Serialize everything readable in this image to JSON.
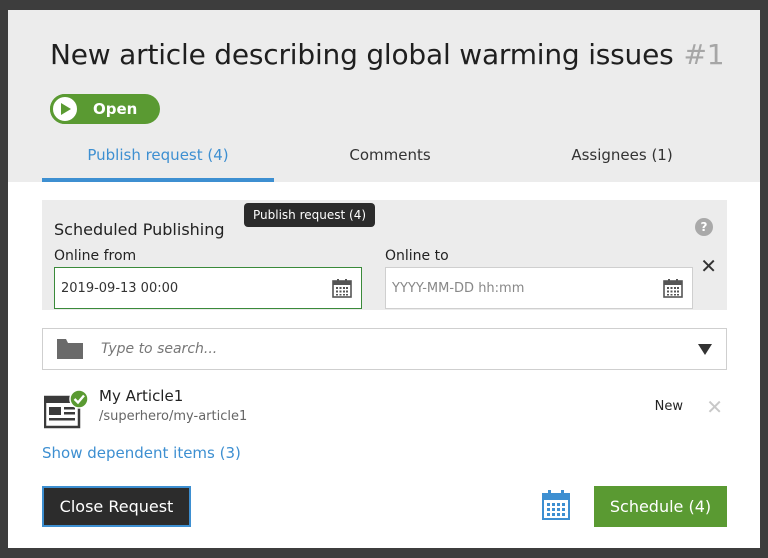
{
  "header": {
    "title": "New article describing global warming issues",
    "number": "#1",
    "status": "Open"
  },
  "tabs": [
    {
      "label": "Publish request (4)",
      "active": true
    },
    {
      "label": "Comments",
      "active": false
    },
    {
      "label": "Assignees (1)",
      "active": false
    }
  ],
  "tooltip": "Publish request (4)",
  "scheduled": {
    "title": "Scheduled Publishing",
    "help": "?",
    "online_from_label": "Online from",
    "online_from_value": "2019-09-13 00:00",
    "online_to_label": "Online to",
    "online_to_placeholder": "YYYY-MM-DD hh:mm",
    "clear": "✕"
  },
  "search": {
    "placeholder": "Type to search..."
  },
  "items": [
    {
      "name": "My Article1",
      "path": "/superhero/my-article1",
      "state": "New"
    }
  ],
  "dependent_link": "Show dependent items (3)",
  "footer": {
    "close_label": "Close Request",
    "schedule_label": "Schedule (4)"
  },
  "colors": {
    "accent": "#3d8fd1",
    "green": "#5a9a32",
    "header_bg": "#ececec"
  }
}
